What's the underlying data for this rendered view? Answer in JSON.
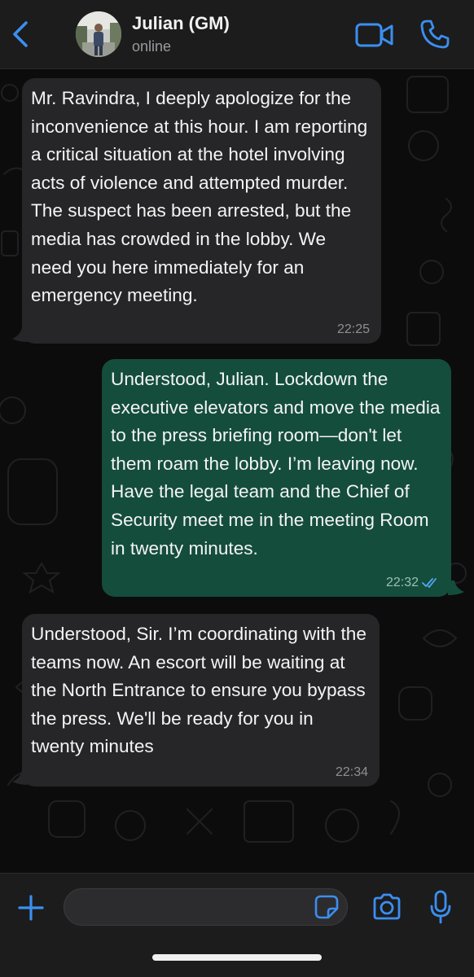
{
  "header": {
    "contact_name": "Julian (GM)",
    "status": "online",
    "icons": [
      "chevron-left-icon",
      "avatar",
      "video-camera-icon",
      "phone-icon"
    ]
  },
  "messages": [
    {
      "direction": "incoming",
      "text": "Mr. Ravindra, I deeply apologize for the inconvenience at this hour. I am reporting a critical situation at the hotel involving acts of violence and attempted murder. The suspect has been arrested, but the media has crowded in the lobby. We need you here immediately for an emergency meeting.",
      "time": "22:25"
    },
    {
      "direction": "outgoing",
      "text": "Understood, Julian. Lockdown the executive elevators and move the media to the press briefing room—don't let them roam the lobby. I’m leaving now. Have the legal team and the Chief of Security meet me in the meeting Room in twenty minutes.",
      "time": "22:32",
      "receipt": "read"
    },
    {
      "direction": "incoming",
      "text": "Understood, Sir. I’m coordinating with the teams now. An escort will be waiting at the North Entrance to ensure you bypass the press. We'll be ready for you in twenty minutes",
      "time": "22:34"
    }
  ],
  "composer": {
    "value": "",
    "icons": [
      "plus-icon",
      "sticker-icon",
      "camera-icon",
      "microphone-icon"
    ]
  },
  "colors": {
    "accent": "#3b8ff0",
    "incoming_bubble": "#262628",
    "outgoing_bubble": "#144d3c",
    "read_receipt": "#53a6f5",
    "background": "#0c0c0d"
  }
}
